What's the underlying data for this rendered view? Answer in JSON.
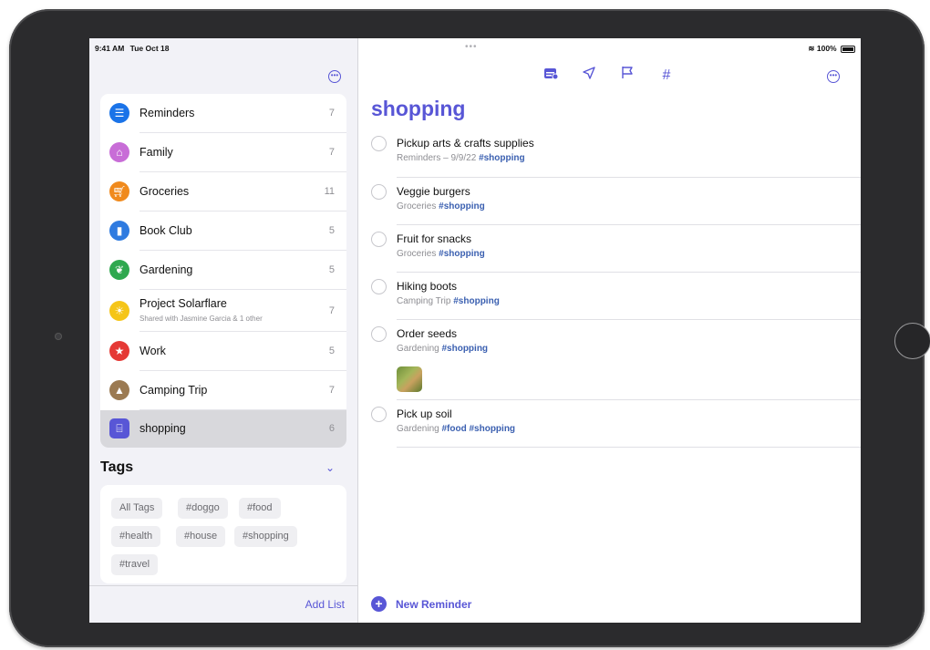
{
  "status_bar": {
    "time": "9:41 AM",
    "date": "Tue Oct 18",
    "battery": "100%"
  },
  "sidebar": {
    "more_icon": "ellipsis-circle-icon",
    "lists": [
      {
        "name": "Reminders",
        "count": "7",
        "icon": "list-bullet-icon",
        "color": "#1a73e8"
      },
      {
        "name": "Family",
        "count": "7",
        "icon": "house-icon",
        "color": "#c86dd7"
      },
      {
        "name": "Groceries",
        "count": "11",
        "icon": "cart-icon",
        "color": "#f08a1d"
      },
      {
        "name": "Book Club",
        "count": "5",
        "icon": "bookmark-icon",
        "color": "#2f7be0"
      },
      {
        "name": "Gardening",
        "count": "5",
        "icon": "leaf-icon",
        "color": "#2fa84f"
      },
      {
        "name": "Project Solarflare",
        "subtitle": "Shared with Jasmine Garcia & 1 other",
        "count": "7",
        "icon": "sun-icon",
        "color": "#f5c518"
      },
      {
        "name": "Work",
        "count": "5",
        "icon": "star-icon",
        "color": "#e53935"
      },
      {
        "name": "Camping Trip",
        "count": "7",
        "icon": "tent-icon",
        "color": "#9b7a52"
      },
      {
        "name": "shopping",
        "count": "6",
        "icon": "basket-icon",
        "color": "#5856d6"
      }
    ],
    "tags_title": "Tags",
    "tags": [
      "All Tags",
      "#doggo",
      "#food",
      "#health",
      "#house",
      "#shopping",
      "#travel"
    ],
    "add_list": "Add List"
  },
  "main": {
    "title": "shopping",
    "reminders": [
      {
        "title": "Pickup arts & crafts supplies",
        "list": "Reminders – 9/9/22",
        "tags": "#shopping"
      },
      {
        "title": "Veggie burgers",
        "list": "Groceries",
        "tags": "#shopping"
      },
      {
        "title": "Fruit for snacks",
        "list": "Groceries",
        "tags": "#shopping"
      },
      {
        "title": "Hiking boots",
        "list": "Camping Trip",
        "tags": "#shopping"
      },
      {
        "title": "Order seeds",
        "list": "Gardening",
        "tags": "#shopping"
      },
      {
        "title": "Pick up soil",
        "list": "Gardening",
        "tags": "#food #shopping"
      }
    ],
    "new_reminder": "New Reminder"
  }
}
